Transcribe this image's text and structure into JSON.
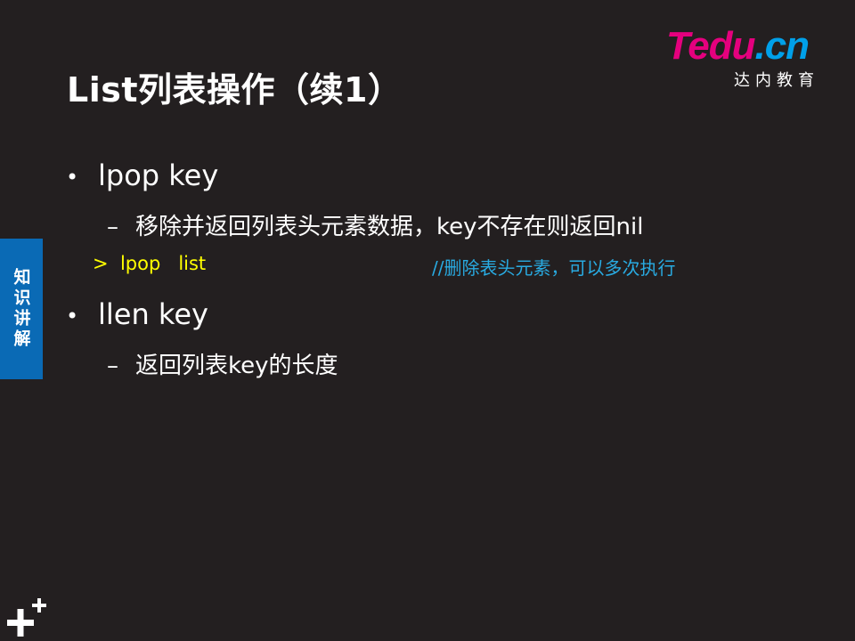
{
  "slide": {
    "title": "List列表操作（续1）",
    "side_tab": "知识讲解",
    "logo": {
      "main_t": "T",
      "main_rest": "edu",
      "main_dot_cn": ".cn",
      "sub": "达内教育"
    },
    "bullets": [
      {
        "bullet_char": "•",
        "text": "lpop key",
        "sub_dash": "–",
        "sub_text": "移除并返回列表头元素数据，key不存在则返回nil"
      },
      {
        "bullet_char": "•",
        "text": "llen key",
        "sub_dash": "–",
        "sub_text": "返回列表key的长度"
      }
    ],
    "code_line": ">  lpop   list",
    "code_comment": "//删除表头元素，可以多次执行"
  },
  "colors": {
    "background": "#231f20",
    "code": "#ffff00",
    "comment": "#29abe2",
    "side_tab": "#0a6ab5",
    "logo_pink": "#e5007e",
    "logo_blue": "#00a0e9"
  },
  "icons": {
    "corner": "plus-decoration-icon"
  }
}
